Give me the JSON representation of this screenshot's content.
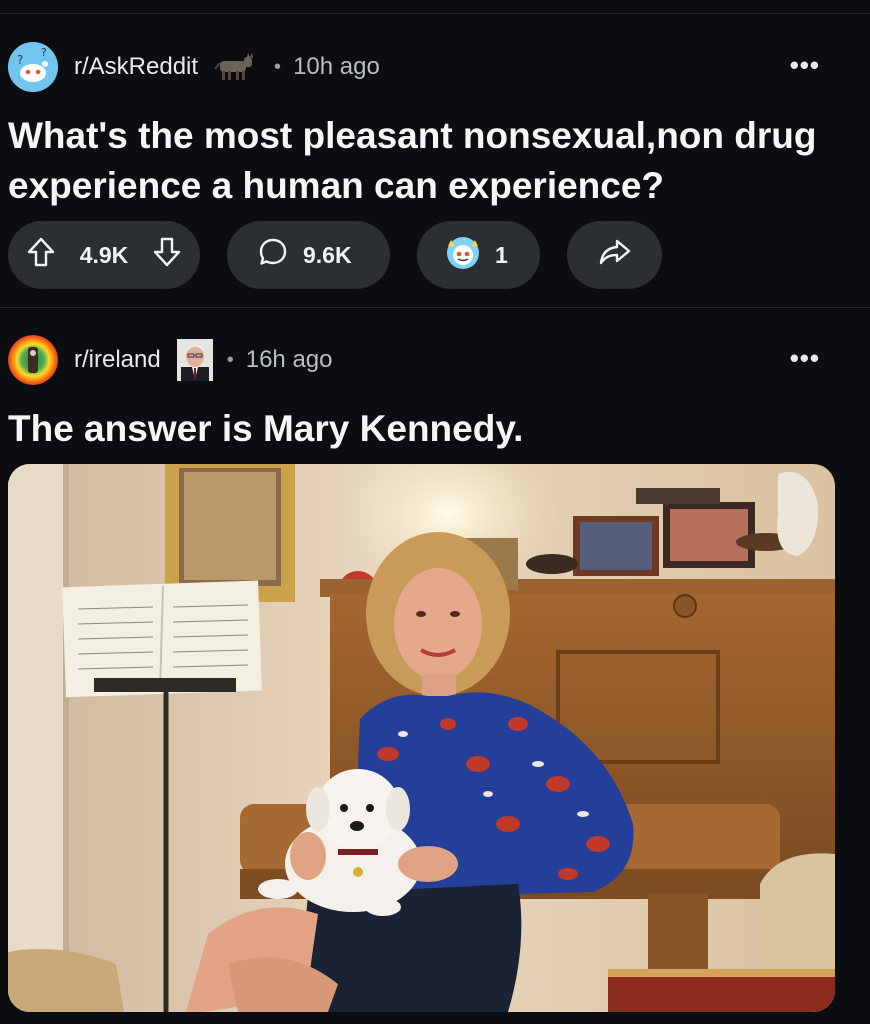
{
  "posts": [
    {
      "subreddit": "r/AskReddit",
      "time": "10h ago",
      "separator": "•",
      "more_icon": "•••",
      "title": "What's the most pleasant nonsexual,non drug experience a human can experience?",
      "upvotes": "4.9K",
      "comments": "9.6K",
      "awards": "1",
      "icons": [
        "upvote-icon",
        "downvote-icon",
        "comment-icon",
        "award-icon",
        "share-icon"
      ]
    },
    {
      "subreddit": "r/ireland",
      "time": "16h ago",
      "separator": "•",
      "more_icon": "•••",
      "title": "The answer is Mary Kennedy."
    }
  ],
  "colors": {
    "background": "#0b0d10",
    "pill": "#2b2f33",
    "askreddit_avatar": "#74c4f0",
    "text": "#f1f3f5"
  }
}
